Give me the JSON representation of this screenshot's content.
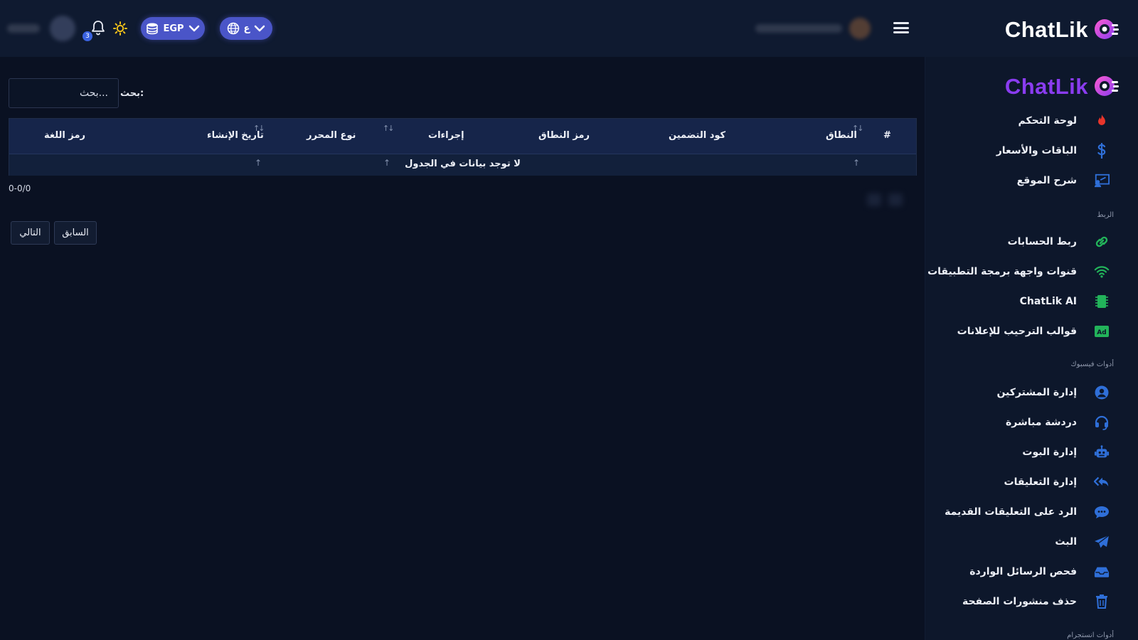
{
  "app": {
    "brand": "ChatLik"
  },
  "header": {
    "language_label": "ع",
    "currency_label": "EGP",
    "notification_count": "3"
  },
  "sidebar": {
    "brand": "ChatLik",
    "items": [
      {
        "label": "لوحة التحكم",
        "icon": "fire-icon"
      },
      {
        "label": "الباقات والأسعار",
        "icon": "dollar-icon"
      },
      {
        "label": "شرح الموقع",
        "icon": "presentation-icon"
      }
    ],
    "section_link": "الربط",
    "link_items": [
      {
        "label": "ربط الحسابات",
        "icon": "link-icon"
      },
      {
        "label": "قنوات واجهة برمجة التطبيقات",
        "icon": "wifi-icon"
      },
      {
        "label": "ChatLik AI",
        "icon": "chip-icon"
      },
      {
        "label": "قوالب الترحيب للإعلانات",
        "icon": "ad-icon"
      }
    ],
    "section_facebook": "أدوات فيسبوك",
    "facebook_items": [
      {
        "label": "إدارة المشتركين",
        "icon": "user-circle-icon"
      },
      {
        "label": "دردشة مباشرة",
        "icon": "headset-icon"
      },
      {
        "label": "إدارة البوت",
        "icon": "robot-icon"
      },
      {
        "label": "إدارة التعليقات",
        "icon": "reply-all-icon"
      },
      {
        "label": "الرد على التعليقات القديمة",
        "icon": "comment-dots-icon"
      },
      {
        "label": "البث",
        "icon": "paper-plane-icon"
      },
      {
        "label": "فحص الرسائل الواردة",
        "icon": "inbox-icon"
      },
      {
        "label": "حذف منشورات الصفحة",
        "icon": "trash-icon"
      }
    ],
    "section_instagram": "أدوات انستجرام"
  },
  "search": {
    "label": "بحث:",
    "placeholder": "بحث..."
  },
  "table": {
    "columns": [
      "#",
      "النطاق",
      "كود التضمين",
      "رمز النطاق",
      "إجراءات",
      "نوع المحرر",
      "تاريخ الإنشاء",
      "رمز اللغة"
    ],
    "empty_message": "لا توجد بيانات في الجدول"
  },
  "pagination": {
    "info": "0-0/0",
    "prev_label": "السابق",
    "next_label": "التالي"
  },
  "colors": {
    "background": "#0a1122",
    "header": "#0f1a30",
    "sidebar": "#0d172b",
    "pill": "#4a55c8",
    "brand_purple": "#8a3cf0",
    "accent_blue": "#2f6fd8",
    "accent_green": "#22b35a"
  }
}
